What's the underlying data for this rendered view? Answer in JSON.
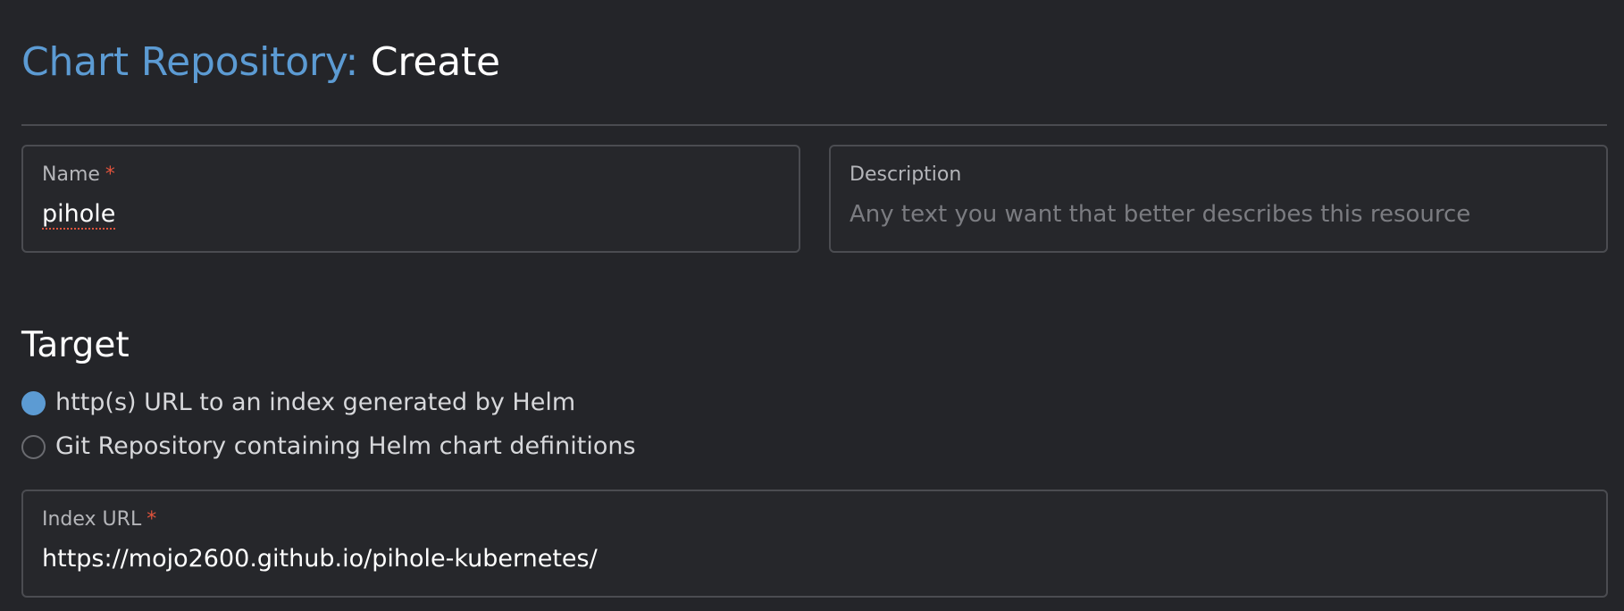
{
  "header": {
    "title_prefix": "Chart Repository:",
    "title_action": "Create"
  },
  "form": {
    "name": {
      "label": "Name",
      "required_mark": "*",
      "value": "pihole"
    },
    "description": {
      "label": "Description",
      "placeholder": "Any text you want that better describes this resource",
      "value": ""
    }
  },
  "target": {
    "heading": "Target",
    "options": [
      {
        "label": "http(s) URL to an index generated by Helm",
        "selected": true
      },
      {
        "label": "Git Repository containing Helm chart definitions",
        "selected": false
      }
    ],
    "index_url": {
      "label": "Index URL",
      "required_mark": "*",
      "value": "https://mojo2600.github.io/pihole-kubernetes/"
    }
  },
  "colors": {
    "background": "#242529",
    "accent": "#5c9bd3",
    "required": "#e0533c",
    "border": "#4b4c51"
  }
}
